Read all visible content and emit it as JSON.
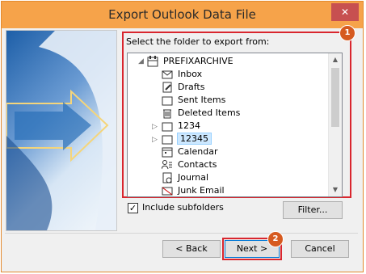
{
  "window": {
    "title": "Export Outlook Data File",
    "close_glyph": "✕"
  },
  "prompt": "Select the folder to export from:",
  "tree": {
    "root": "PREFIXARCHIVE",
    "items": [
      {
        "label": "Inbox",
        "icon": "inbox-icon"
      },
      {
        "label": "Drafts",
        "icon": "drafts-icon"
      },
      {
        "label": "Sent Items",
        "icon": "folder-icon"
      },
      {
        "label": "Deleted Items",
        "icon": "trash-icon"
      },
      {
        "label": "1234",
        "icon": "folder-icon",
        "expandable": true
      },
      {
        "label": "12345",
        "icon": "folder-icon",
        "expandable": true,
        "selected": true
      },
      {
        "label": "Calendar",
        "icon": "calendar-icon"
      },
      {
        "label": "Contacts",
        "icon": "contacts-icon"
      },
      {
        "label": "Journal",
        "icon": "journal-icon"
      },
      {
        "label": "Junk Email",
        "icon": "junk-icon"
      }
    ]
  },
  "include_subfolders": {
    "label": "Include subfolders",
    "checked": true
  },
  "buttons": {
    "filter": "Filter...",
    "back": "< Back",
    "next": "Next >",
    "cancel": "Cancel"
  },
  "badges": {
    "one": "1",
    "two": "2"
  },
  "colors": {
    "highlight": "#d9262e",
    "badge": "#d65a1f",
    "titlebar": "#f6a34a"
  }
}
